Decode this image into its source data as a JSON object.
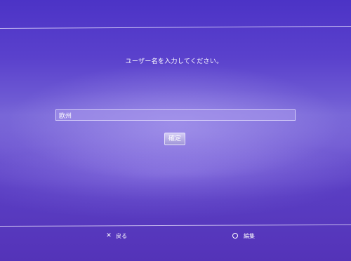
{
  "screen": {
    "prompt": "ユーザー名を入力してください。"
  },
  "name_field": {
    "value": "欧州"
  },
  "confirm_button": {
    "label": "確定"
  },
  "hints": {
    "back": {
      "icon": "cross-icon",
      "glyph": "✕",
      "label": "戻る"
    },
    "edit": {
      "icon": "circle-icon",
      "label": "編集"
    }
  },
  "colors": {
    "background_top": "#4c33c6",
    "background_mid": "#7563d6",
    "background_bottom": "#5433b8",
    "text": "#ffffff"
  }
}
